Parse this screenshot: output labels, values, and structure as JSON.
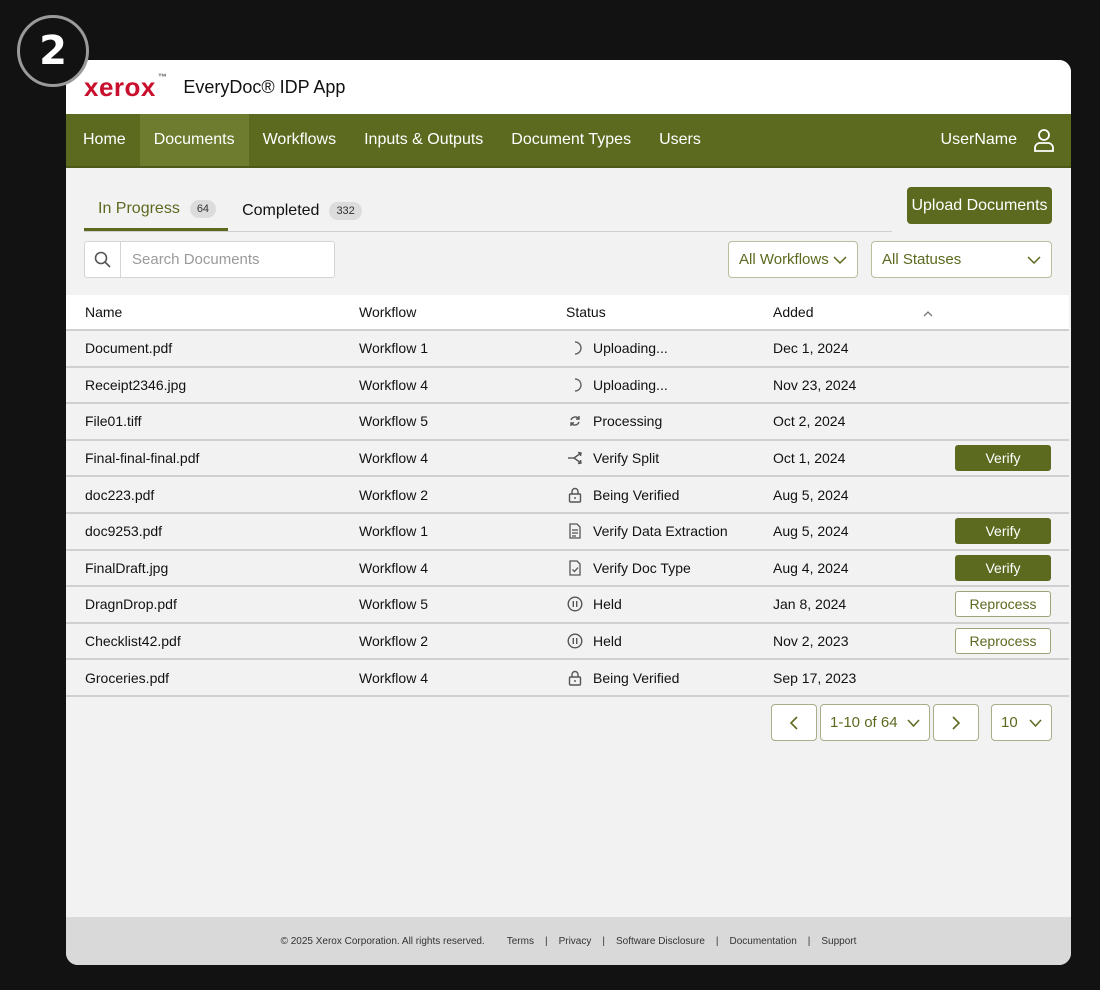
{
  "step_badge": "2",
  "header": {
    "logo": "xerox",
    "logo_mark": "™",
    "app_title": "EveryDoc® IDP App"
  },
  "nav": {
    "items": [
      {
        "label": "Home"
      },
      {
        "label": "Documents"
      },
      {
        "label": "Workflows"
      },
      {
        "label": "Inputs & Outputs"
      },
      {
        "label": "Document Types"
      },
      {
        "label": "Users"
      }
    ],
    "active_index": 1,
    "user": "UserName",
    "user_icon": "user-icon"
  },
  "tabs": [
    {
      "label": "In Progress",
      "count": "64"
    },
    {
      "label": "Completed",
      "count": "332"
    }
  ],
  "upload_label": "Upload Documents",
  "search": {
    "placeholder": "Search Documents",
    "value": ""
  },
  "filters": {
    "workflow": "All Workflows",
    "status": "All Statuses"
  },
  "table": {
    "headers": {
      "name": "Name",
      "workflow": "Workflow",
      "status": "Status",
      "added": "Added"
    },
    "rows": [
      {
        "name": "Document.pdf",
        "workflow": "Workflow 1",
        "status": "Uploading...",
        "icon": "spinner-icon",
        "added": "Dec 1, 2024",
        "action": ""
      },
      {
        "name": "Receipt2346.jpg",
        "workflow": "Workflow 4",
        "status": "Uploading...",
        "icon": "spinner-icon",
        "added": "Nov 23, 2024",
        "action": ""
      },
      {
        "name": "File01.tiff",
        "workflow": "Workflow 5",
        "status": "Processing",
        "icon": "refresh-icon",
        "added": "Oct 2, 2024",
        "action": ""
      },
      {
        "name": "Final-final-final.pdf",
        "workflow": "Workflow 4",
        "status": "Verify Split",
        "icon": "split-icon",
        "added": "Oct 1, 2024",
        "action": "Verify"
      },
      {
        "name": "doc223.pdf",
        "workflow": "Workflow 2",
        "status": "Being Verified",
        "icon": "lock-icon",
        "added": "Aug 5, 2024",
        "action": ""
      },
      {
        "name": "doc9253.pdf",
        "workflow": "Workflow 1",
        "status": "Verify Data Extraction",
        "icon": "data-extraction-icon",
        "added": "Aug 5, 2024",
        "action": "Verify"
      },
      {
        "name": "FinalDraft.jpg",
        "workflow": "Workflow 4",
        "status": "Verify Doc Type",
        "icon": "doc-check-icon",
        "added": "Aug 4, 2024",
        "action": "Verify"
      },
      {
        "name": "DragnDrop.pdf",
        "workflow": "Workflow 5",
        "status": "Held",
        "icon": "pause-icon",
        "added": "Jan 8, 2024",
        "action": "Reprocess"
      },
      {
        "name": "Checklist42.pdf",
        "workflow": "Workflow 2",
        "status": "Held",
        "icon": "pause-icon",
        "added": "Nov 2, 2023",
        "action": "Reprocess"
      },
      {
        "name": "Groceries.pdf",
        "workflow": "Workflow 4",
        "status": "Being Verified",
        "icon": "lock-icon",
        "added": "Sep 17, 2023",
        "action": ""
      }
    ]
  },
  "pagination": {
    "range": "1-10 of 64",
    "page_size": "10"
  },
  "footer": {
    "copyright": "© 2025 Xerox Corporation. All rights reserved.",
    "links": [
      "Terms",
      "Privacy",
      "Software Disclosure",
      "Documentation",
      "Support"
    ]
  },
  "colors": {
    "brand_green": "#5b6a1f",
    "brand_red": "#c8102e"
  }
}
